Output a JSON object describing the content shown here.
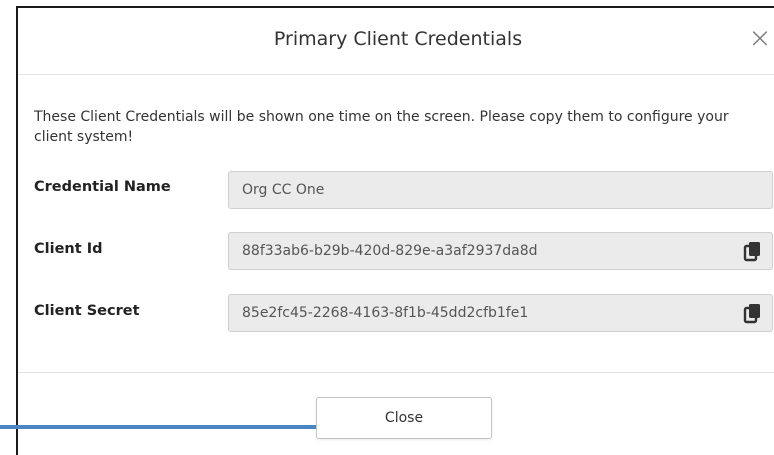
{
  "dialog": {
    "title": "Primary Client Credentials",
    "close_glyph": "×",
    "intro_text": "These Client Credentials will be shown one time on the screen. Please copy them to configure your client system!",
    "fields": [
      {
        "label": "Credential Name",
        "value": "Org CC One",
        "copyable": false
      },
      {
        "label": "Client Id",
        "value": "88f33ab6-b29b-420d-829e-a3af2937da8d",
        "copyable": true,
        "icon": "copy-icon"
      },
      {
        "label": "Client Secret",
        "value": "85e2fc45-2268-4163-8f1b-45dd2cfb1fe1",
        "copyable": true,
        "icon": "copy-icon"
      }
    ],
    "close_button_label": "Close"
  },
  "colors": {
    "pointer_line": "#4a86c5",
    "field_bg": "#ebebeb",
    "title_text": "#333333"
  }
}
